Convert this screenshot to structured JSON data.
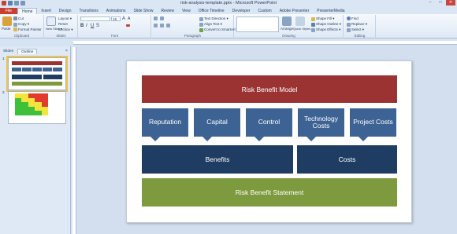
{
  "window": {
    "title": "risk-analysis-template.pptx - Microsoft PowerPoint",
    "controls": [
      "–",
      "□",
      "✕"
    ]
  },
  "tabs": [
    "File",
    "Home",
    "Insert",
    "Design",
    "Transitions",
    "Animations",
    "Slide Show",
    "Review",
    "View",
    "Office Timeline",
    "Developer",
    "Custom",
    "Adobe Presenter",
    "PresenterMedia"
  ],
  "ribbon": {
    "clipboard": {
      "paste": "Paste",
      "cut": "Cut",
      "copy": "Copy ▾",
      "format_painter": "Format Painter",
      "label": "Clipboard"
    },
    "slides": {
      "new_slide": "New Slide ▾",
      "layout": "Layout ▾",
      "reset": "Reset",
      "section": "Section ▾",
      "label": "Slides"
    },
    "font": {
      "size": "18",
      "label": "Font"
    },
    "paragraph": {
      "text_direction": "Text Direction ▾",
      "align_text": "Align Text ▾",
      "convert_smartart": "Convert to SmartArt ▾",
      "label": "Paragraph"
    },
    "drawing": {
      "arrange": "Arrange",
      "quick_styles": "Quick Styles ▾",
      "shape_fill": "Shape Fill ▾",
      "shape_outline": "Shape Outline ▾",
      "shape_effects": "Shape Effects ▾",
      "label": "Drawing"
    },
    "editing": {
      "find": "Find",
      "replace": "Replace ▾",
      "select": "Select ▾",
      "label": "Editing"
    }
  },
  "left_pane": {
    "tabs": [
      "Slides",
      "Outline"
    ],
    "close": "×",
    "thumbnails": [
      {
        "number": "1"
      },
      {
        "number": "2"
      }
    ]
  },
  "slide": {
    "title": "Risk Benefit Model",
    "factors": [
      "Reputation",
      "Capital",
      "Control",
      "Technology Costs",
      "Project Costs"
    ],
    "benefits": "Benefits",
    "costs": "Costs",
    "statement": "Risk Benefit Statement"
  },
  "colors": {
    "title_red": "#9b3332",
    "factor_blue": "#3d6294",
    "navy": "#1f3d63",
    "statement_green": "#7d9a3e",
    "file_tab": "#c8412f"
  }
}
